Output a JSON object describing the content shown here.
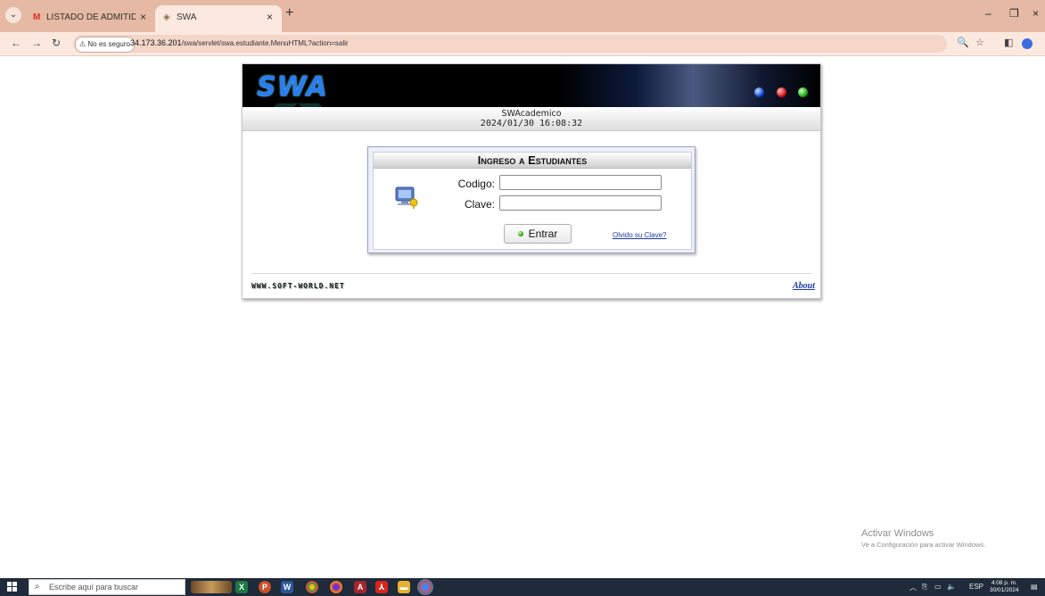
{
  "browser": {
    "tabs": [
      {
        "label": "LISTADO DE ADMITIDOS APROB",
        "favicon": "M",
        "favicon_color": "#d93025",
        "active": false
      },
      {
        "label": "SWA",
        "favicon": "◈",
        "favicon_color": "#8a6d3b",
        "active": true
      }
    ],
    "security_label": "No es seguro",
    "url_host": "34.173.36.201",
    "url_path": "/swa/servlet/swa.estudiante.MenuHTML?action=salir"
  },
  "page": {
    "logo_text": "SWA",
    "app_name": "SWAcademico",
    "datetime": "2024/01/30 16:08:32",
    "login": {
      "title": "Ingreso a Estudiantes",
      "codigo_label": "Codigo:",
      "codigo_value": "",
      "clave_label": "Clave:",
      "clave_value": "",
      "submit_label": "Entrar",
      "forgot_label": "Olvido su Clave?"
    },
    "footer_site": "WWW.SOFT-WORLD.NET",
    "footer_about": "About"
  },
  "watermark": {
    "line1": "Activar Windows",
    "line2": "Ve a Configuración para activar Windows."
  },
  "taskbar": {
    "search_placeholder": "Escribe aquí para buscar",
    "lang": "ESP",
    "time": "4:08 p. m.",
    "date": "30/01/2024"
  },
  "colors": {
    "tabbar": "#e5b9a4",
    "addressbar": "#fbe9e0",
    "link": "#1a3aa8",
    "taskbar": "#1f2a3a"
  }
}
